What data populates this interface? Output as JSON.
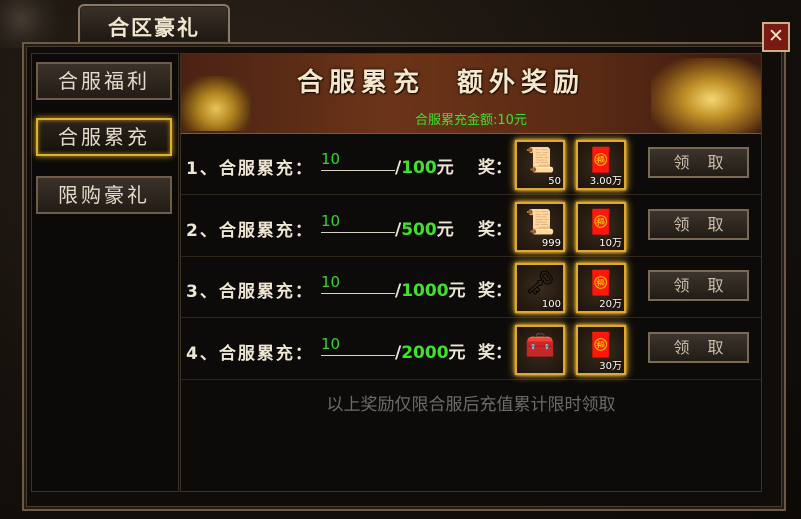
{
  "window": {
    "title": "合区豪礼",
    "close_symbol": "✕"
  },
  "sidebar": {
    "items": [
      {
        "label": "合服福利",
        "active": false
      },
      {
        "label": "合服累充",
        "active": true
      },
      {
        "label": "限购豪礼",
        "active": false
      }
    ]
  },
  "banner": {
    "title": "合服累充　额外奖励",
    "total_text": "合服累充金额:10元"
  },
  "rows": [
    {
      "label": "1、合服累充：",
      "current": "10",
      "slash": "/",
      "target": "100",
      "unit": "元",
      "reward_label": "奖：",
      "rewards": [
        {
          "icon": "scroll-icon",
          "glyph": "📜",
          "count": "50"
        },
        {
          "icon": "gold-ingot-icon",
          "glyph": "🧧",
          "count": "3.00万"
        }
      ],
      "claim_label": "领取"
    },
    {
      "label": "2、合服累充：",
      "current": "10",
      "slash": "/",
      "target": "500",
      "unit": "元",
      "reward_label": "奖：",
      "rewards": [
        {
          "icon": "scroll-icon",
          "glyph": "📜",
          "count": "999"
        },
        {
          "icon": "gold-ingot-icon",
          "glyph": "🧧",
          "count": "10万"
        }
      ],
      "claim_label": "领取"
    },
    {
      "label": "3、合服累充：",
      "current": "10",
      "slash": "/",
      "target": "1000",
      "unit": "元",
      "reward_label": "奖：",
      "rewards": [
        {
          "icon": "wand-icon",
          "glyph": "🗝",
          "count": "100"
        },
        {
          "icon": "gold-ingot-icon",
          "glyph": "🧧",
          "count": "20万"
        }
      ],
      "claim_label": "领取"
    },
    {
      "label": "4、合服累充：",
      "current": "10",
      "slash": "/",
      "target": "2000",
      "unit": "元",
      "reward_label": "奖：",
      "rewards": [
        {
          "icon": "treasure-chest-icon",
          "glyph": "🧰",
          "count": ""
        },
        {
          "icon": "gold-ingot-icon",
          "glyph": "🧧",
          "count": "30万"
        }
      ],
      "claim_label": "领取"
    }
  ],
  "footer": {
    "note": "以上奖励仅限合服后充值累计限时领取"
  },
  "colors": {
    "accent_gold": "#e0b22a",
    "value_green": "#3ee22a",
    "text_light": "#efe6d4"
  }
}
